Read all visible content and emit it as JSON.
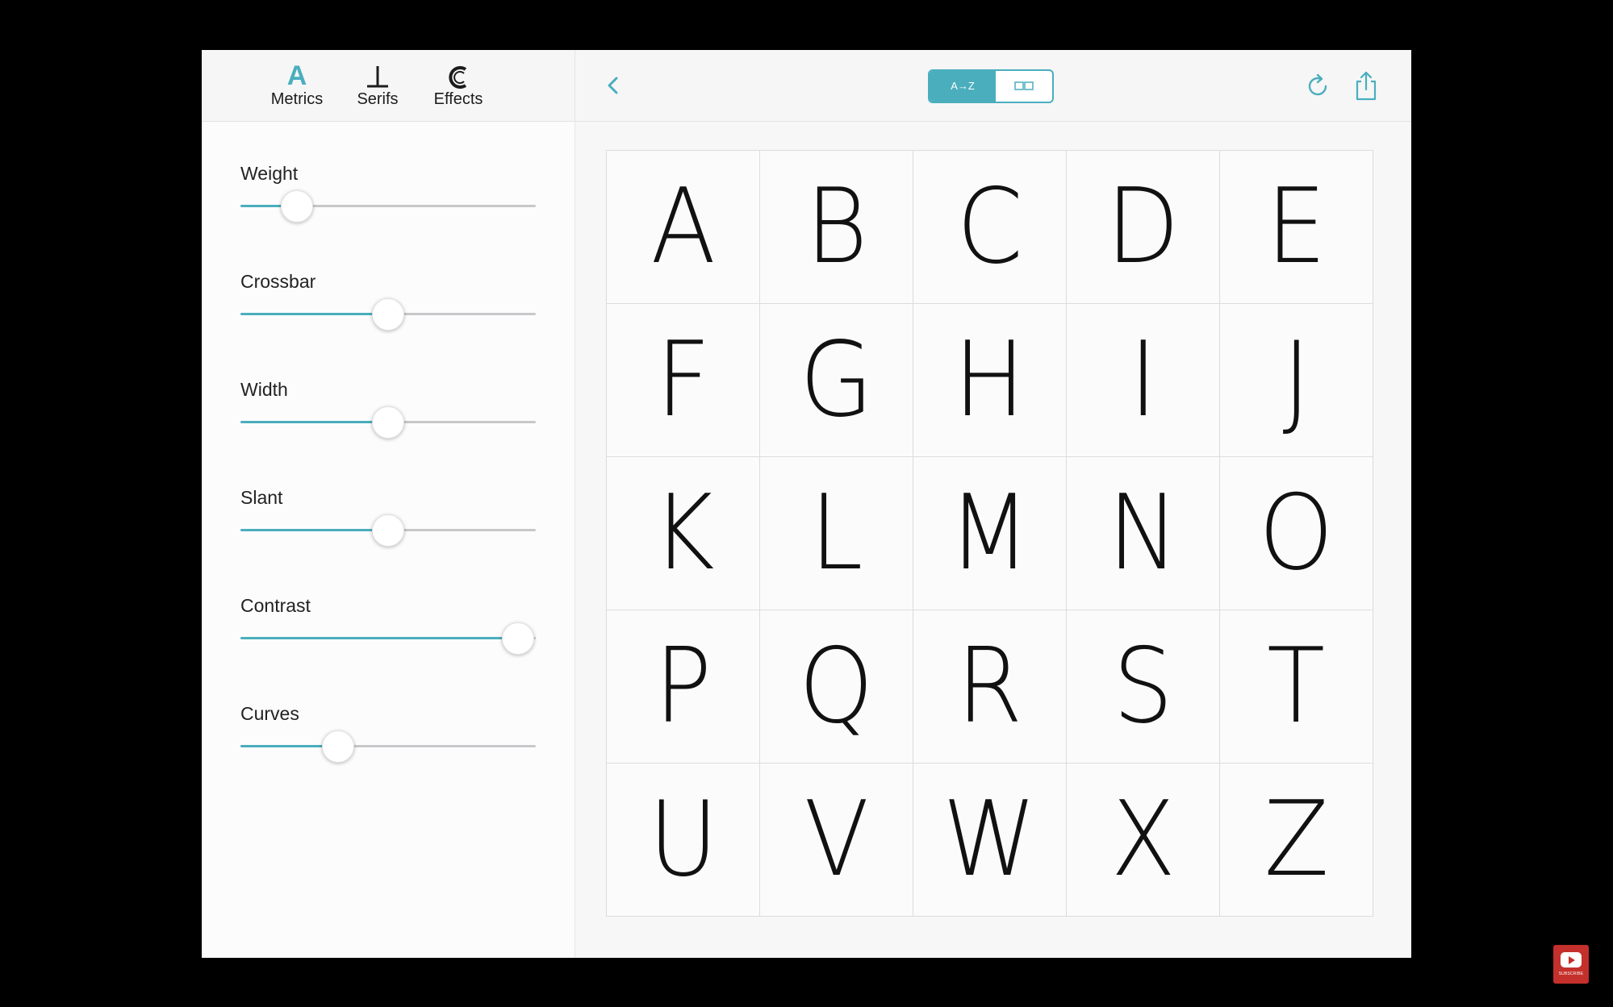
{
  "tools": [
    {
      "label": "Metrics",
      "icon": "A",
      "icon_name": "metrics-icon",
      "active": true
    },
    {
      "label": "Serifs",
      "icon": "⊥",
      "icon_name": "serifs-icon",
      "active": false
    },
    {
      "label": "Effects",
      "icon": "C",
      "icon_name": "effects-icon",
      "active": false
    }
  ],
  "sliders": [
    {
      "label": "Weight",
      "value": 0.19
    },
    {
      "label": "Crossbar",
      "value": 0.5
    },
    {
      "label": "Width",
      "value": 0.5
    },
    {
      "label": "Slant",
      "value": 0.5
    },
    {
      "label": "Contrast",
      "value": 0.94
    },
    {
      "label": "Curves",
      "value": 0.33
    }
  ],
  "toolbar": {
    "toggle_az_label": "A→Z",
    "back_icon": "chevron-left-icon",
    "refresh_icon": "refresh-icon",
    "share_icon": "share-icon"
  },
  "glyphs": [
    "A",
    "B",
    "C",
    "D",
    "E",
    "F",
    "G",
    "H",
    "I",
    "J",
    "K",
    "L",
    "M",
    "N",
    "O",
    "P",
    "Q",
    "R",
    "S",
    "T",
    "U",
    "V",
    "W",
    "X",
    "Z"
  ],
  "colors": {
    "accent": "#4aaebd",
    "track": "#c8c8ca",
    "background": "#fdfcfd"
  },
  "badge": {
    "text": "SUBSCRIBE"
  }
}
